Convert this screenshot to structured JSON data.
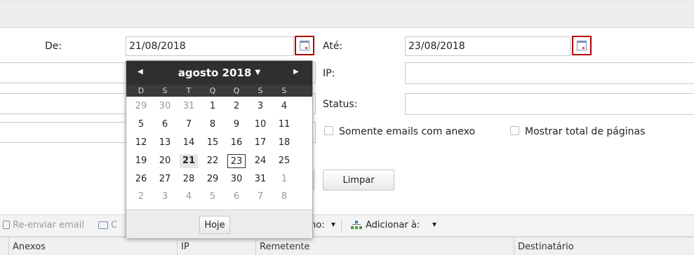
{
  "filters": {
    "de_label": "De:",
    "de_value": "21/08/2018",
    "ate_label": "Até:",
    "ate_value": "23/08/2018",
    "ip_label": "IP:",
    "status_label": "Status:",
    "somente_anexo_label": "Somente emails com anexo",
    "mostrar_total_label": "Mostrar total de páginas",
    "limpar_label": "Limpar"
  },
  "datepicker": {
    "month_label": "agosto 2018",
    "prev_arrow": "◀",
    "next_arrow": "▶",
    "title_caret": "▼",
    "weekdays": [
      "D",
      "S",
      "T",
      "Q",
      "Q",
      "S",
      "S"
    ],
    "weeks": [
      [
        "29",
        "30",
        "31",
        "1",
        "2",
        "3",
        "4"
      ],
      [
        "5",
        "6",
        "7",
        "8",
        "9",
        "10",
        "11"
      ],
      [
        "12",
        "13",
        "14",
        "15",
        "16",
        "17",
        "18"
      ],
      [
        "19",
        "20",
        "21",
        "22",
        "23",
        "24",
        "25"
      ],
      [
        "26",
        "27",
        "28",
        "29",
        "30",
        "31",
        "1"
      ],
      [
        "2",
        "3",
        "4",
        "5",
        "6",
        "7",
        "8"
      ]
    ],
    "selected_day": "21",
    "today_day": "23",
    "today_button": "Hoje"
  },
  "toolbar": {
    "reenviar_label": "Re-enviar email",
    "partial_label_c": "C",
    "partial_label_mo": "no:",
    "dropdown_caret": "▾",
    "adicionar_label": "Adicionar à:"
  },
  "grid": {
    "columns": [
      "Anexos",
      "IP",
      "Remetente",
      "Destinatário"
    ]
  },
  "colors": {
    "highlight_border": "#b00000",
    "datepicker_header": "#2f2f2f"
  }
}
